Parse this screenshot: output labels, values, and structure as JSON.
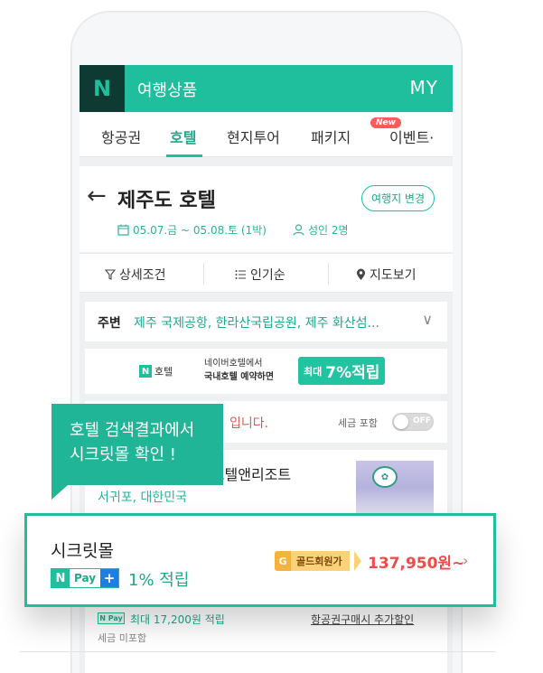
{
  "header": {
    "logo": "N",
    "title": "여행상품",
    "my": "MY"
  },
  "tabs": [
    {
      "label": "항공권",
      "active": false
    },
    {
      "label": "호텔",
      "active": true
    },
    {
      "label": "현지투어",
      "active": false
    },
    {
      "label": "패키지",
      "active": false
    },
    {
      "label": "이벤트·",
      "active": false,
      "badge": "New"
    }
  ],
  "search": {
    "city_title": "제주도 호텔",
    "change_button": "여행지 변경",
    "dates": "05.07.금 ~ 05.08.토 (1박)",
    "guests": "성인 2명"
  },
  "filters": [
    {
      "label": "상세조건",
      "icon": "filter-icon"
    },
    {
      "label": "인기순",
      "icon": "list-icon"
    },
    {
      "label": "지도보기",
      "icon": "map-pin-icon"
    }
  ],
  "nearby": {
    "label": "주변",
    "places": "제주 국제공항, 한라산국립공원, 제주 화산섬..."
  },
  "promo": {
    "n_mark": "N",
    "hotel": "호텔",
    "line1": "네이버호텔에서",
    "line2": "국내호텔 예약하면",
    "badge_prefix": "최대",
    "badge_value": "7%적립"
  },
  "info": {
    "notice": "입니다.",
    "tax_label": "세금 포함",
    "toggle": "OFF"
  },
  "listing": {
    "hotel_name": "드 호텔앤리조트",
    "location": "서귀포, 대한민국",
    "npay_mini": "N Pay",
    "max_points": "최대 17,200원 적립",
    "airline_link": "항공권구매시 추가할인",
    "tax_excluded": "세금 미포함"
  },
  "tooltip": {
    "line1": "호텔 검색결과에서",
    "line2": "시크릿몰 확인 !"
  },
  "secret_mall": {
    "title": "시크릿몰",
    "npay_n": "N",
    "npay_pay": "Pay",
    "npay_plus": "+",
    "points": "1% 적립",
    "gold_g": "G",
    "gold_label": "골드회원가",
    "price": "137,950원~"
  },
  "colors": {
    "brand": "#1fbf9e",
    "price": "#ef4b4b",
    "gold": "#fbd27a"
  }
}
